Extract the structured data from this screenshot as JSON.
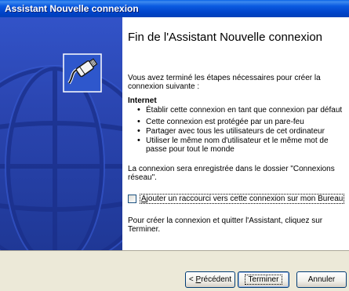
{
  "window": {
    "title": "Assistant Nouvelle connexion"
  },
  "icons": {
    "wizard": "network-cable-plug-icon",
    "globe": "globe-watermark"
  },
  "content": {
    "heading": "Fin de l'Assistant Nouvelle connexion",
    "intro": "Vous avez terminé les étapes nécessaires pour créer la connexion suivante :",
    "profile_name": "Internet",
    "bullets": [
      "Établir cette connexion en tant que connexion par défaut",
      "Cette connexion est protégée par un pare-feu",
      "Partager avec tous les utilisateurs de cet ordinateur",
      "Utiliser le même nom d'utilisateur et le même mot de passe pour tout le monde"
    ],
    "save_note": "La connexion sera enregistrée dans le dossier \"Connexions réseau\".",
    "shortcut_checkbox": {
      "label_prefix": "",
      "label_underlined": "A",
      "label_rest": "jouter un raccourci vers cette connexion sur mon Bureau",
      "checked": false
    },
    "finish_text": "Pour créer la connexion et quitter l'Assistant, cliquez sur Terminer."
  },
  "buttons": {
    "back_prefix": "< ",
    "back_underlined": "P",
    "back_rest": "récédent",
    "finish": "Terminer",
    "cancel": "Annuler"
  },
  "colors": {
    "titlebar": "#0a5ae0",
    "side_panel": "#2a45b0",
    "dialog_bg": "#ece9d8"
  }
}
